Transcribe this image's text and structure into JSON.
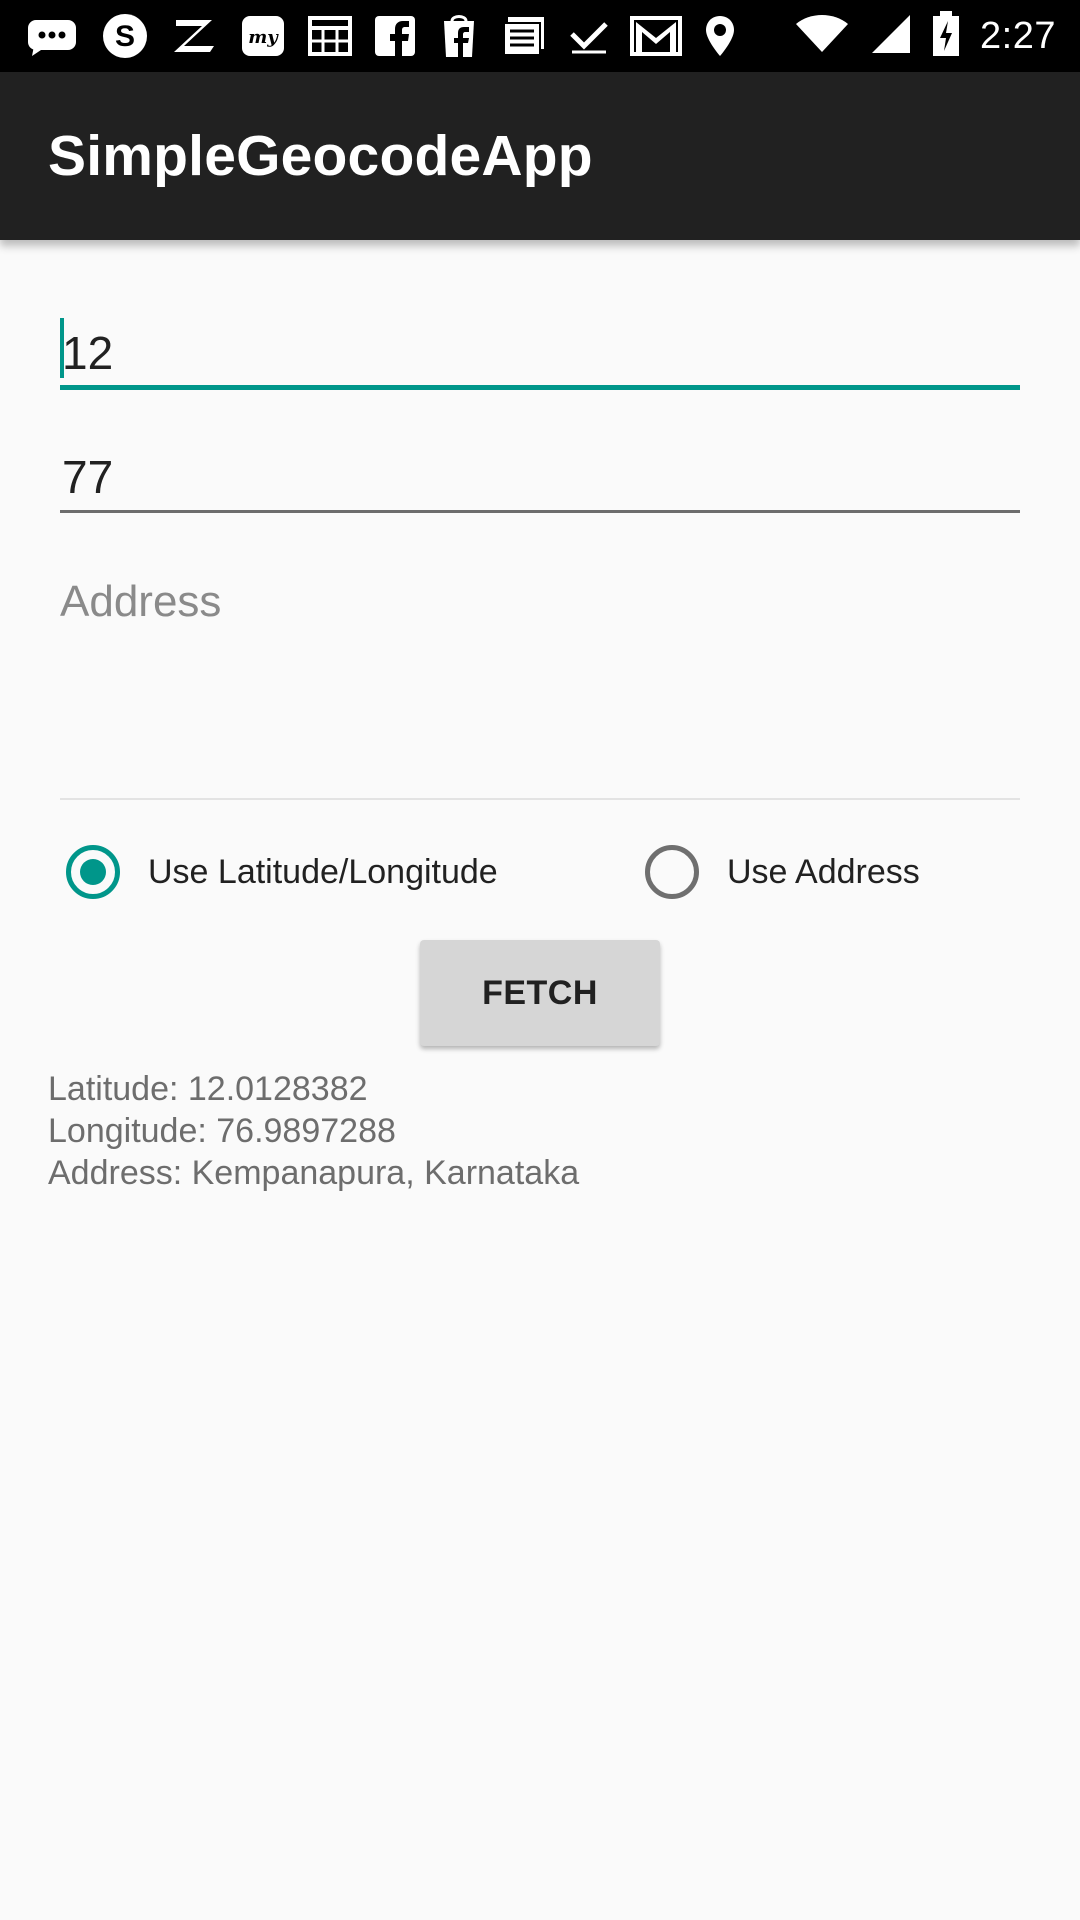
{
  "status_bar": {
    "time": "2:27",
    "icons": [
      "messages-icon",
      "skype-icon",
      "zomato-icon",
      "mytoys-icon",
      "calendar-icon",
      "facebook-icon",
      "facebook-lite-icon",
      "news-icon",
      "tasks-icon",
      "gmail-icon",
      "location-icon",
      "wifi-icon",
      "signal-icon",
      "battery-icon"
    ]
  },
  "app_bar": {
    "title": "SimpleGeocodeApp"
  },
  "form": {
    "latitude_value": "12",
    "longitude_value": "77",
    "address_placeholder": "Address"
  },
  "radios": {
    "latlng_label": "Use Latitude/Longitude",
    "address_label": "Use Address",
    "selected": "latlng"
  },
  "actions": {
    "fetch_label": "FETCH"
  },
  "result": {
    "latitude_line": "Latitude: 12.0128382",
    "longitude_line": "Longitude: 76.9897288",
    "address_line": "Address: Kempanapura, Karnataka"
  },
  "colors": {
    "accent": "#00968a",
    "app_bar": "#212121",
    "status_bar": "#000000",
    "background": "#fafafa"
  }
}
